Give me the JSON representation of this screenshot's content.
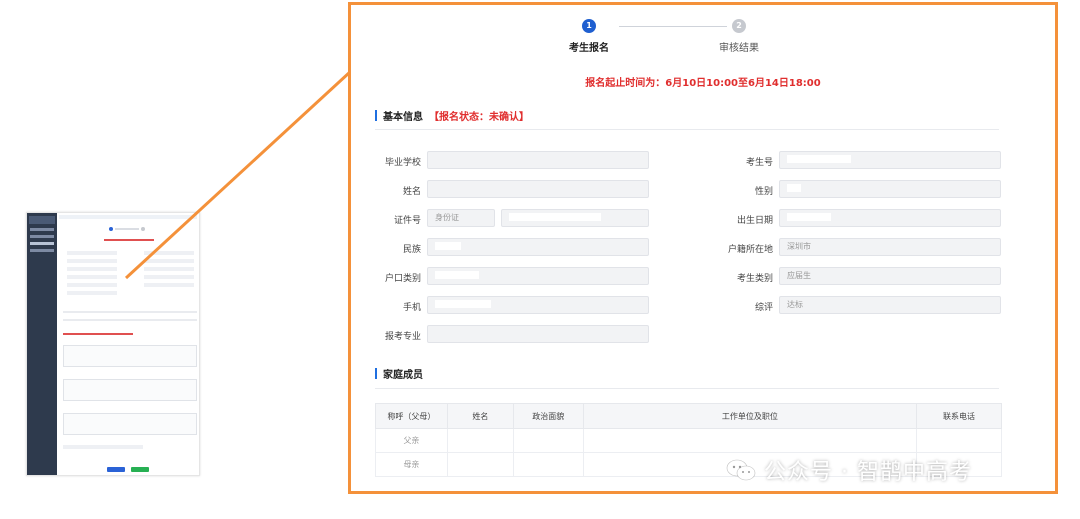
{
  "steps": [
    {
      "num": "1",
      "label": "考生报名"
    },
    {
      "num": "2",
      "label": "审核结果"
    }
  ],
  "deadline": "报名起止时间为：6月10日10:00至6月14日18:00",
  "basic_info": {
    "title": "基本信息",
    "status": "【报名状态：未确认】",
    "fields": {
      "school": {
        "label": "毕业学校",
        "value": ""
      },
      "exam_no": {
        "label": "考生号",
        "value": ""
      },
      "name": {
        "label": "姓名",
        "value": ""
      },
      "gender": {
        "label": "性别",
        "value": ""
      },
      "id_type": {
        "label": "证件号",
        "value": "身份证"
      },
      "id_number": {
        "value": ""
      },
      "birth": {
        "label": "出生日期",
        "value": ""
      },
      "ethnicity": {
        "label": "民族",
        "value": ""
      },
      "hukou_place": {
        "label": "户籍所在地",
        "value": "深圳市"
      },
      "hukou_type": {
        "label": "户口类别",
        "value": ""
      },
      "candidate_type": {
        "label": "考生类别",
        "value": "应届生"
      },
      "phone": {
        "label": "手机",
        "value": ""
      },
      "rating": {
        "label": "综评",
        "value": "达标"
      },
      "major": {
        "label": "报考专业",
        "value": ""
      }
    }
  },
  "family": {
    "title": "家庭成员",
    "columns": [
      "称呼（父母）",
      "姓名",
      "政治面貌",
      "工作单位及职位",
      "联系电话"
    ],
    "rows": [
      {
        "relation": "父亲"
      },
      {
        "relation": "母亲"
      }
    ]
  },
  "watermark": "公众号 · 智鹊中高考",
  "colors": {
    "frame": "#f4913a",
    "accent": "#1f5fd0",
    "alert": "#e02e2e"
  }
}
